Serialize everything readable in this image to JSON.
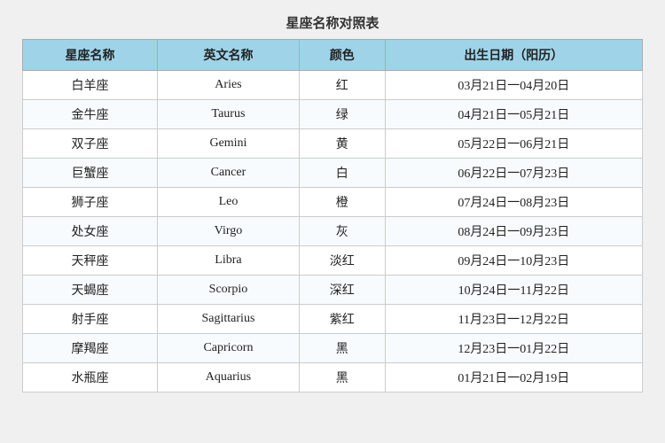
{
  "title": "星座名称对照表",
  "headers": [
    "星座名称",
    "英文名称",
    "颜色",
    "出生日期（阳历）"
  ],
  "rows": [
    {
      "zh": "白羊座",
      "en": "Aries",
      "color": "红",
      "dates": "03月21日一04月20日"
    },
    {
      "zh": "金牛座",
      "en": "Taurus",
      "color": "绿",
      "dates": "04月21日一05月21日"
    },
    {
      "zh": "双子座",
      "en": "Gemini",
      "color": "黄",
      "dates": "05月22日一06月21日"
    },
    {
      "zh": "巨蟹座",
      "en": "Cancer",
      "color": "白",
      "dates": "06月22日一07月23日"
    },
    {
      "zh": "狮子座",
      "en": "Leo",
      "color": "橙",
      "dates": "07月24日一08月23日"
    },
    {
      "zh": "处女座",
      "en": "Virgo",
      "color": "灰",
      "dates": "08月24日一09月23日"
    },
    {
      "zh": "天秤座",
      "en": "Libra",
      "color": "淡红",
      "dates": "09月24日一10月23日"
    },
    {
      "zh": "天蝎座",
      "en": "Scorpio",
      "color": "深红",
      "dates": "10月24日一11月22日"
    },
    {
      "zh": "射手座",
      "en": "Sagittarius",
      "color": "紫红",
      "dates": "11月23日一12月22日"
    },
    {
      "zh": "摩羯座",
      "en": "Capricorn",
      "color": "黑",
      "dates": "12月23日一01月22日"
    },
    {
      "zh": "水瓶座",
      "en": "Aquarius",
      "color": "黑",
      "dates": "01月21日一02月19日"
    }
  ]
}
